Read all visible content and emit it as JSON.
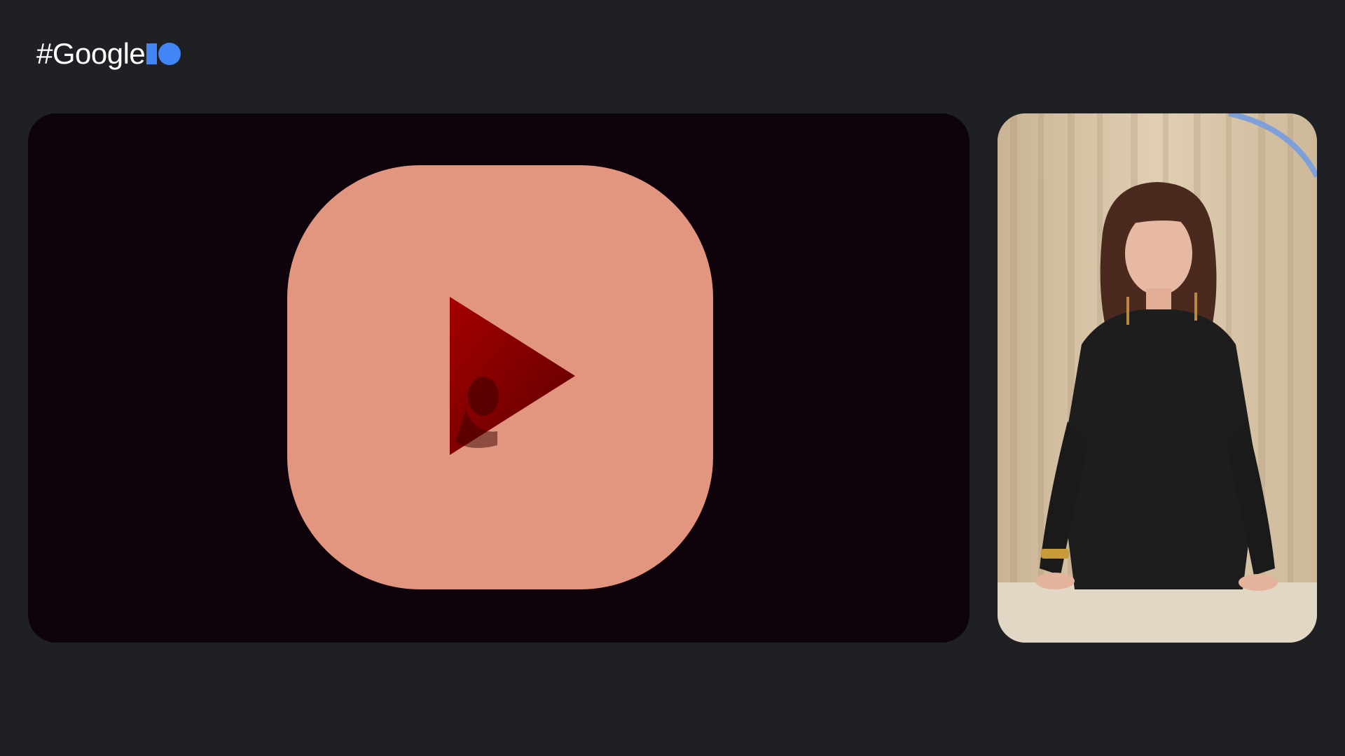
{
  "header": {
    "logo_text": "#Google",
    "logo_mark": "I/O",
    "accent_color": "#4285f4"
  },
  "slide": {
    "background_color": "#0e030a",
    "tile_color": "#e3967f",
    "icon": "play-icon",
    "icon_fill": "#8a0000"
  },
  "speaker_feed": {
    "background_color": "#d9c6a9"
  }
}
